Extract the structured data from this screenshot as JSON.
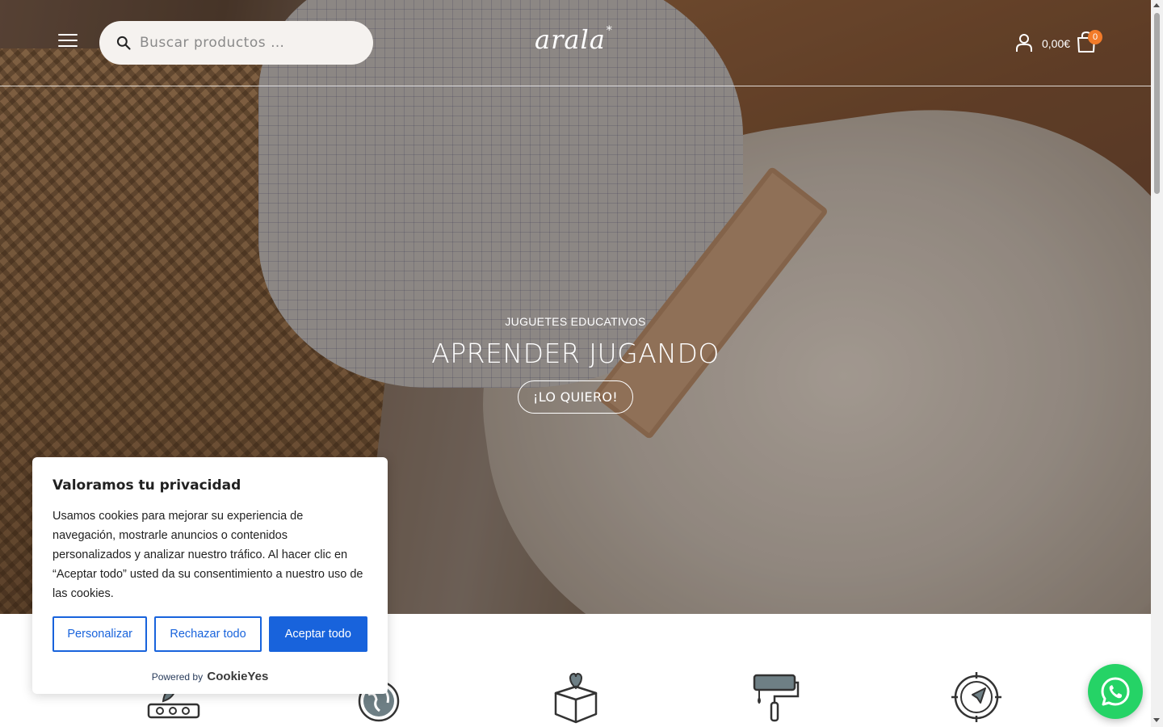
{
  "header": {
    "search_placeholder": "Buscar productos …",
    "logo_text": "arala",
    "logo_mark": "*",
    "cart_total": "0,00€",
    "cart_count": "0"
  },
  "hero": {
    "subtitle": "JUGUETES EDUCATIVOS",
    "title": "APRENDER JUGANDO",
    "cta_label": "¡LO QUIERO!"
  },
  "cookie_banner": {
    "title": "Valoramos tu privacidad",
    "text": "Usamos cookies para mejorar su experiencia de navegación, mostrarle anuncios o contenidos personalizados y analizar nuestro tráfico. Al hacer clic en “Aceptar todo” usted da su consentimiento a nuestro uso de las cookies.",
    "customize_label": "Personalizar",
    "reject_label": "Rechazar todo",
    "accept_label": "Aceptar todo",
    "powered_by": "Powered by",
    "brand": "CookieYes"
  },
  "features": {
    "icons": [
      "sustainable-icon",
      "globe-icon",
      "gift-box-heart-icon",
      "paint-roller-icon",
      "compass-icon"
    ]
  },
  "colors": {
    "accent": "#1863dc",
    "cart_badge": "#f37b29",
    "whatsapp": "#25d366"
  },
  "icons": {
    "menu": "hamburger-menu-icon",
    "search": "search-icon",
    "account": "user-icon",
    "cart": "shopping-bag-icon",
    "whatsapp": "whatsapp-icon"
  }
}
